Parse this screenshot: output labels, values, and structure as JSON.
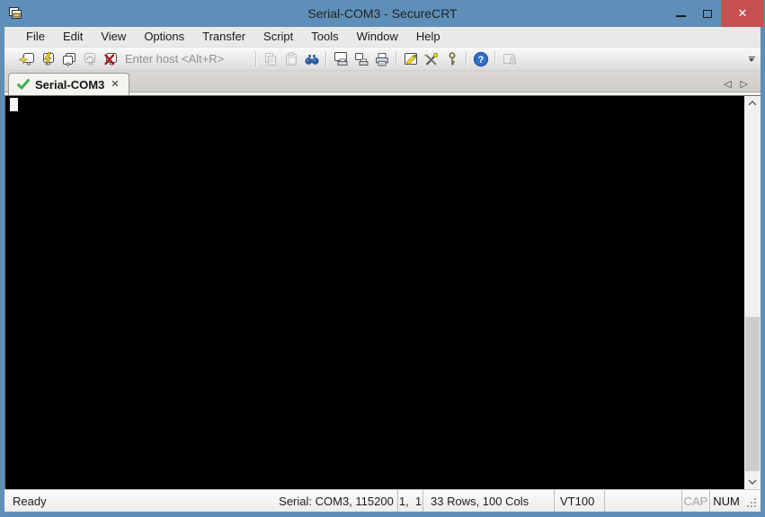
{
  "window": {
    "title": "Serial-COM3 - SecureCRT",
    "controls": [
      "minimize",
      "maximize",
      "close"
    ]
  },
  "glyphs": {
    "close": "✕",
    "tab_close": "✕",
    "tab_scroll_left": "◁",
    "tab_scroll_right": "▷"
  },
  "menu": {
    "items": [
      "File",
      "Edit",
      "View",
      "Options",
      "Transfer",
      "Script",
      "Tools",
      "Window",
      "Help"
    ]
  },
  "toolbar": {
    "host_placeholder": "Enter host <Alt+R>",
    "icons": [
      "connect",
      "quick-connect",
      "connect-in-tab",
      "reconnect",
      "disconnect",
      "copy",
      "paste",
      "find",
      "print-screen",
      "print-selection",
      "print",
      "session-options",
      "global-options",
      "key-agent",
      "help",
      "screen-lock",
      "toolbar-overflow"
    ]
  },
  "tabbar": {
    "tabs": [
      {
        "label": "Serial-COM3",
        "status": "connected"
      }
    ]
  },
  "statusbar": {
    "ready": "Ready",
    "serial": "Serial: COM3, 115200",
    "cursor_position": "1,  1",
    "dimensions": "33 Rows, 100 Cols",
    "emulation": "VT100",
    "caps_indicator": "CAP",
    "num_indicator": "NUM"
  },
  "colors": {
    "titlebar": "#5e8fb9",
    "close_button": "#c75050",
    "terminal_bg": "#000000",
    "tab_active_bg": "#f4f3f0",
    "connected_check": "#3fae49"
  }
}
